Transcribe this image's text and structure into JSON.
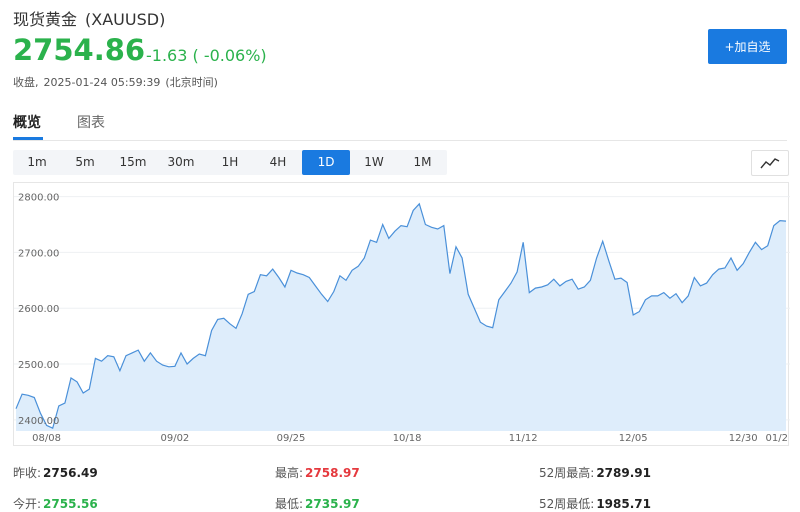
{
  "header": {
    "name": "现货黄金",
    "code": "(XAUUSD)",
    "price": "2754.86",
    "change": "-1.63 ( -0.06%)",
    "close_label": "收盘,",
    "close_time": "2025-01-24 05:59:39",
    "timezone": "(北京时间)",
    "add_watchlist": "+加自选"
  },
  "tabs": [
    {
      "label": "概览",
      "active": true
    },
    {
      "label": "图表",
      "active": false
    }
  ],
  "periods": [
    {
      "label": "1m",
      "active": false
    },
    {
      "label": "5m",
      "active": false
    },
    {
      "label": "15m",
      "active": false
    },
    {
      "label": "30m",
      "active": false
    },
    {
      "label": "1H",
      "active": false
    },
    {
      "label": "4H",
      "active": false
    },
    {
      "label": "1D",
      "active": true
    },
    {
      "label": "1W",
      "active": false
    },
    {
      "label": "1M",
      "active": false
    }
  ],
  "chart_type_icon": "line-chart-icon",
  "colors": {
    "accent": "#1a7ae0",
    "price_green": "#2bb24c",
    "price_red": "#e5393e",
    "line": "#4a90d9",
    "area_fill": "#deedfb"
  },
  "chart_data": {
    "type": "area",
    "ylim": [
      2380,
      2810
    ],
    "y_ticks": [
      "2800.00",
      "2700.00",
      "2600.00",
      "2500.00",
      "2400.00"
    ],
    "y_tick_values": [
      2800,
      2700,
      2600,
      2500,
      2400
    ],
    "x_labels": [
      {
        "label": "08/08",
        "index": 5
      },
      {
        "label": "09/02",
        "index": 26
      },
      {
        "label": "09/25",
        "index": 45
      },
      {
        "label": "10/18",
        "index": 64
      },
      {
        "label": "11/12",
        "index": 83
      },
      {
        "label": "12/05",
        "index": 101
      },
      {
        "label": "12/30",
        "index": 119
      },
      {
        "label": "01/2",
        "index": 137
      }
    ],
    "values": [
      2420,
      2446,
      2444,
      2440,
      2412,
      2390,
      2385,
      2425,
      2430,
      2475,
      2468,
      2448,
      2455,
      2510,
      2505,
      2515,
      2513,
      2488,
      2515,
      2520,
      2525,
      2505,
      2520,
      2505,
      2498,
      2495,
      2496,
      2520,
      2500,
      2510,
      2518,
      2515,
      2560,
      2580,
      2582,
      2572,
      2564,
      2590,
      2625,
      2630,
      2660,
      2658,
      2670,
      2655,
      2638,
      2668,
      2663,
      2660,
      2655,
      2640,
      2625,
      2612,
      2630,
      2658,
      2650,
      2668,
      2675,
      2690,
      2722,
      2718,
      2750,
      2725,
      2738,
      2748,
      2746,
      2775,
      2787,
      2750,
      2745,
      2742,
      2748,
      2662,
      2710,
      2690,
      2625,
      2600,
      2575,
      2568,
      2565,
      2615,
      2630,
      2645,
      2665,
      2718,
      2628,
      2636,
      2638,
      2642,
      2652,
      2640,
      2648,
      2652,
      2634,
      2638,
      2650,
      2690,
      2720,
      2685,
      2652,
      2654,
      2646,
      2588,
      2594,
      2615,
      2622,
      2622,
      2628,
      2618,
      2626,
      2610,
      2622,
      2655,
      2640,
      2645,
      2660,
      2670,
      2672,
      2690,
      2668,
      2680,
      2700,
      2718,
      2705,
      2712,
      2748,
      2757,
      2756
    ]
  },
  "stats": {
    "prev_close_label": "昨收:",
    "prev_close": "2756.49",
    "open_label": "今开:",
    "open": "2755.56",
    "high_label": "最高:",
    "high": "2758.97",
    "low_label": "最低:",
    "low": "2735.97",
    "week52_high_label": "52周最高:",
    "week52_high": "2789.91",
    "week52_low_label": "52周最低:",
    "week52_low": "1985.71"
  }
}
